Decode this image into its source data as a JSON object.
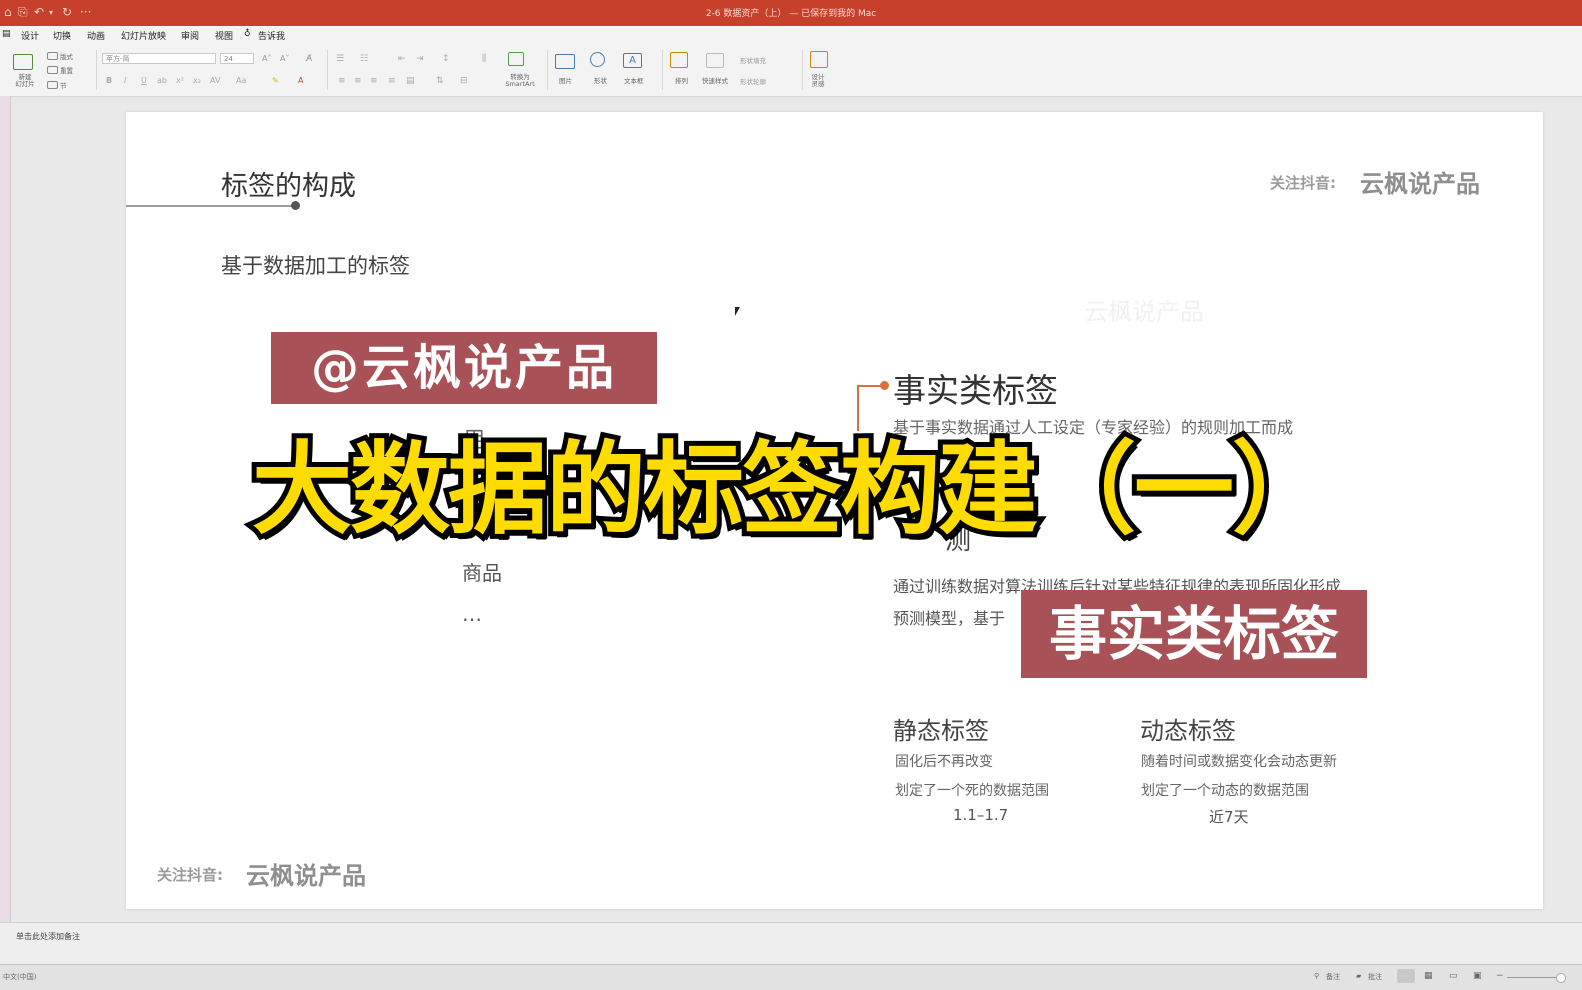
{
  "titlebar": {
    "doc_title": "2-6 数据资产（上） — 已保存到我的 Mac",
    "quick_access": [
      "⌂",
      "⎘",
      "↶",
      "▾",
      "↻",
      "···"
    ]
  },
  "menu": [
    "设计",
    "切换",
    "动画",
    "幻灯片放映",
    "审阅",
    "视图",
    "告诉我"
  ],
  "ribbon": {
    "new_slide": "新建\n幻灯片",
    "layout": "版式",
    "reset": "重置",
    "section": "节",
    "font_name": "苹方-简",
    "font_size": "24",
    "convert_smartart": "转换为\nSmartArt",
    "picture": "图片",
    "shape": "形状",
    "textbox": "文本框",
    "arrange": "排列",
    "quick_styles": "快速样式",
    "shape_fill": "形状填充",
    "shape_outline": "形状轮廓",
    "design_ideas": "设计\n灵感"
  },
  "slide": {
    "heading": "标签的构成",
    "brand_top_prefix": "关注抖音:",
    "brand_top_name": "云枫说产品",
    "subtitle": "基于数据加工的标签",
    "watermark": "云枫说产品",
    "fact_title": "事实类标签",
    "fact_desc": "基于事实数据通过人工设定（专家经验）的规则加工而成",
    "partial_left_char": "用",
    "partial_pred_char": "测",
    "left_item_goods": "商品",
    "left_item_more": "…",
    "pred_desc_line1": "通过训练数据对算法训练后针对某些特征规律的表现所固化形成",
    "pred_desc_line2": "预测模型，基于",
    "static_title": "静态标签",
    "static_line1": "固化后不再改变",
    "static_line2": "划定了一个死的数据范围",
    "static_example": "1.1–1.7",
    "dynamic_title": "动态标签",
    "dynamic_line1": "随着时间或数据变化会动态更新",
    "dynamic_line2": "划定了一个动态的数据范围",
    "dynamic_example": "近7天",
    "brand_bottom_prefix": "关注抖音:",
    "brand_bottom_name": "云枫说产品"
  },
  "overlay": {
    "handle_banner": "@云枫说产品",
    "big_title": "大数据的标签构建（一）",
    "sub_banner": "事实类标签"
  },
  "notes_placeholder": "单击此处添加备注",
  "status": {
    "language": "中文(中国)",
    "notes_btn": "备注",
    "comments_btn": "批注"
  },
  "colors": {
    "titlebar": "#c6402b",
    "accent_line": "#d8703f",
    "banner": "#a85257",
    "overlay_yellow": "#ffdc00"
  }
}
